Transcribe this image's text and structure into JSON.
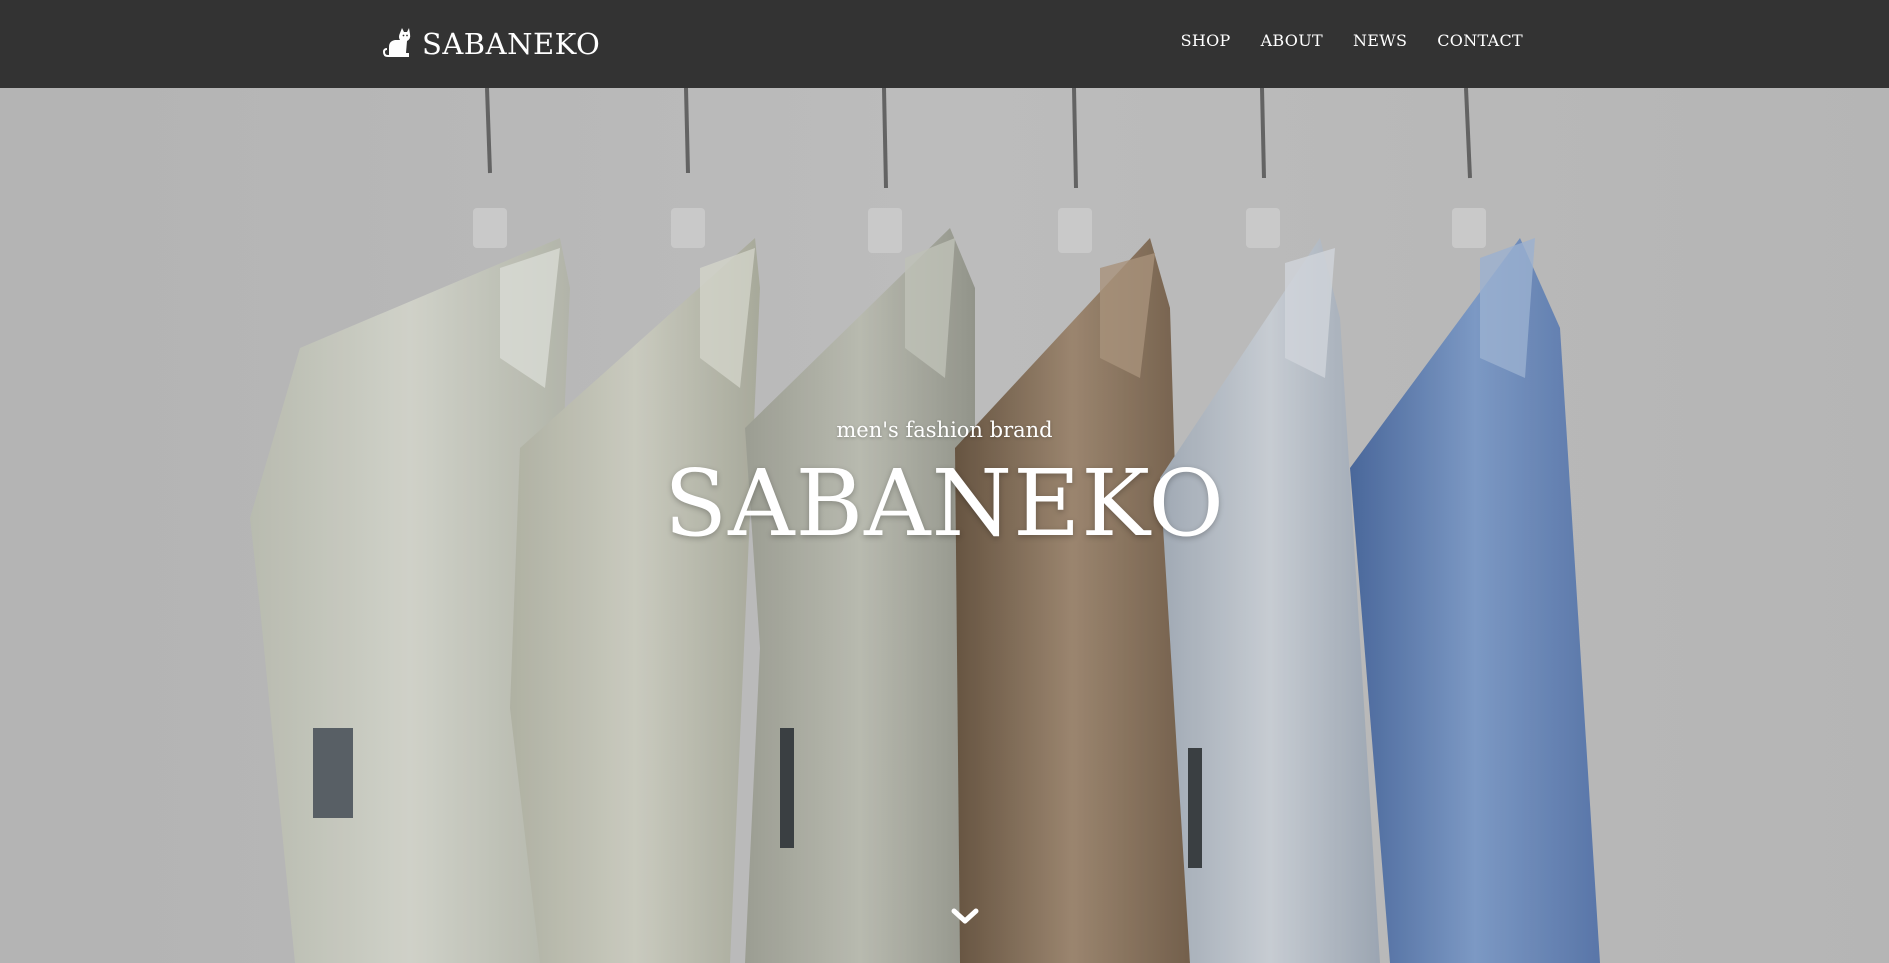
{
  "header": {
    "logo_icon": "cat-icon",
    "logo_text": "SABANEKO",
    "nav": [
      {
        "label": "SHOP"
      },
      {
        "label": "ABOUT"
      },
      {
        "label": "NEWS"
      },
      {
        "label": "CONTACT"
      }
    ],
    "background": "#333333"
  },
  "hero": {
    "subtitle": "men's fashion brand",
    "title": "SABANEKO",
    "scroll_icon": "chevron-down-icon"
  }
}
